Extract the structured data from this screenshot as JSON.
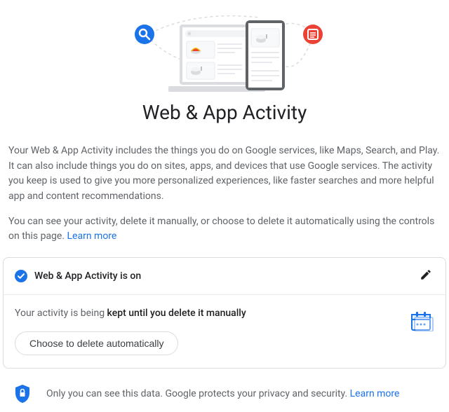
{
  "page": {
    "title": "Web & App Activity"
  },
  "description": {
    "para1": "Your Web & App Activity includes the things you do on Google services, like Maps, Search, and Play. It can also include things you do on sites, apps, and devices that use Google services. The activity you keep is used to give you more personalized experiences, like faster searches and more helpful app and content recommendations.",
    "para2_prefix": "You can see your activity, delete it manually, or choose to delete it automatically using the controls on this page. ",
    "learn_more": "Learn more"
  },
  "card": {
    "status": "Web & App Activity is on",
    "retention_prefix": "Your activity is being ",
    "retention_bold": "kept until you delete it manually",
    "auto_delete_btn": "Choose to delete automatically"
  },
  "privacy": {
    "text_prefix": "Only you can see this data. Google protects your privacy and security. ",
    "learn_more": "Learn more"
  },
  "colors": {
    "accent_blue": "#1a73e8",
    "accent_red": "#ea4335",
    "icon_shield": "#1a73e8"
  }
}
